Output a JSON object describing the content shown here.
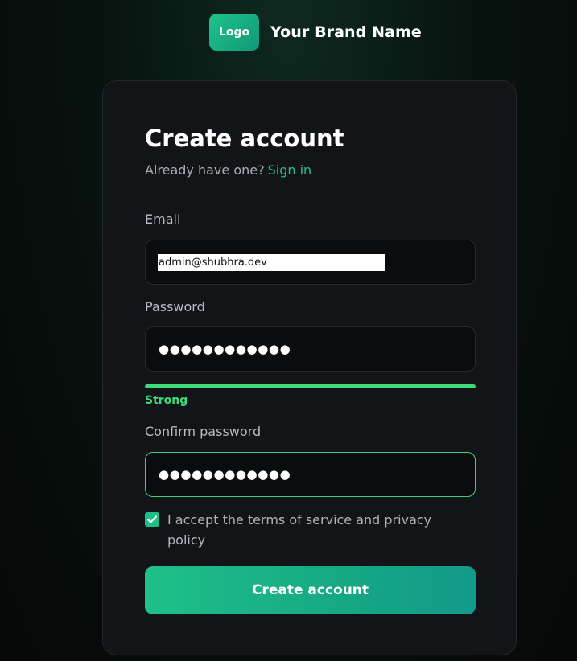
{
  "brand": {
    "logo_text": "Logo",
    "name": "Your Brand Name"
  },
  "form": {
    "title": "Create account",
    "have_account_text": "Already have one?",
    "signin_link": "Sign in",
    "email": {
      "label": "Email",
      "value": "admin@shubhra.dev"
    },
    "password": {
      "label": "Password",
      "masked_value": "●●●●●●●●●●●●",
      "strength_label": "Strong",
      "strength_level": 1.0
    },
    "confirm_password": {
      "label": "Confirm password",
      "masked_value": "●●●●●●●●●●●●"
    },
    "terms": {
      "checked": true,
      "text": "I accept the terms of service and privacy policy"
    },
    "submit_label": "Create account"
  },
  "colors": {
    "accent": "#1fc48e",
    "strength_strong": "#3fd97a",
    "card_background": "#121418"
  }
}
